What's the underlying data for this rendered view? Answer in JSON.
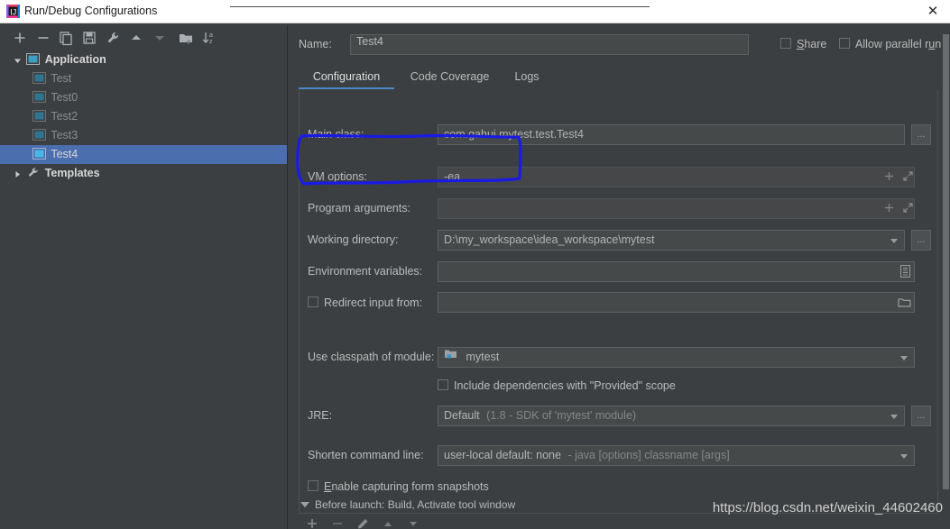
{
  "window": {
    "title": "Run/Debug Configurations",
    "icon": "intellij-idea-icon",
    "close_label": "✕"
  },
  "left_panel": {
    "toolbar": [
      {
        "name": "add-button",
        "glyph": "plus"
      },
      {
        "name": "remove-button",
        "glyph": "minus"
      },
      {
        "name": "copy-configuration-button",
        "glyph": "copy"
      },
      {
        "name": "save-configuration-button",
        "glyph": "save"
      },
      {
        "name": "edit-templates-button",
        "glyph": "wrench"
      },
      {
        "name": "move-up-button",
        "glyph": "arrow-up"
      },
      {
        "name": "move-down-button",
        "glyph": "arrow-down"
      },
      {
        "name": "create-folder-button",
        "glyph": "new-folder"
      },
      {
        "name": "sort-configurations-button",
        "glyph": "sort-az"
      }
    ],
    "tree": [
      {
        "label": "Application",
        "type": "group",
        "expanded": true,
        "selected": false,
        "icon": "application-icon"
      },
      {
        "label": "Test",
        "type": "child",
        "selected": false,
        "icon": "application-icon"
      },
      {
        "label": "Test0",
        "type": "child",
        "selected": false,
        "icon": "application-icon"
      },
      {
        "label": "Test2",
        "type": "child",
        "selected": false,
        "icon": "application-icon"
      },
      {
        "label": "Test3",
        "type": "child",
        "selected": false,
        "icon": "application-icon"
      },
      {
        "label": "Test4",
        "type": "child",
        "selected": true,
        "icon": "application-icon"
      },
      {
        "label": "Templates",
        "type": "group",
        "expanded": false,
        "selected": false,
        "icon": "wrench-icon"
      }
    ]
  },
  "right_panel": {
    "name_label": "Name:",
    "name_value": "Test4",
    "share_label_before": "S",
    "share_label_after": "hare",
    "parallel_label_before": "Allow parallel r",
    "parallel_label_mid": "u",
    "parallel_label_after": "n",
    "tabs": [
      {
        "label": "Configuration",
        "active": true
      },
      {
        "label": "Code Coverage",
        "active": false
      },
      {
        "label": "Logs",
        "active": false
      }
    ],
    "fields": {
      "main_class_label": "Main class:",
      "main_class_value": "com.gahui.mytest.test.Test4",
      "vm_options_label": "VM options:",
      "vm_options_value": "-ea",
      "program_arguments_label": "Program arguments:",
      "program_arguments_value": "",
      "working_directory_label": "Working directory:",
      "working_directory_value": "D:\\my_workspace\\idea_workspace\\mytest",
      "environment_variables_label": "Environment variables:",
      "environment_variables_value": "",
      "redirect_input_label": "Redirect input from:",
      "redirect_input_value": "",
      "use_classpath_label": "Use classpath of module:",
      "use_classpath_value": "mytest",
      "include_dependencies_label": "Include dependencies with \"Provided\" scope",
      "jre_label": "JRE:",
      "jre_value_main": "Default",
      "jre_value_detail": "(1.8 - SDK of 'mytest' module)",
      "shorten_command_line_label": "Shorten command line:",
      "shorten_value_main": "user-local default: none",
      "shorten_value_detail": "- java [options] classname [args]",
      "enable_snapshots_before": "E",
      "enable_snapshots_after": "nable capturing form snapshots",
      "ellipsis_label": "..."
    }
  },
  "footer": {
    "before_launch_label": "Before launch: Build, Activate tool window",
    "toolbar": [
      {
        "name": "add-task-button",
        "glyph": "plus"
      },
      {
        "name": "remove-task-button",
        "glyph": "minus"
      },
      {
        "name": "edit-task-button",
        "glyph": "pencil"
      },
      {
        "name": "move-task-up-button",
        "glyph": "arrow-up"
      },
      {
        "name": "move-task-down-button",
        "glyph": "arrow-down"
      }
    ]
  },
  "watermark": "https://blog.csdn.net/weixin_44602460",
  "annotation": {
    "shape": "hand-drawn-rectangle",
    "color": "#1a1ae6",
    "target": "vm-options-row"
  },
  "colors": {
    "background": "#3c3f41",
    "input_background": "#45494a",
    "selection": "#4b6eaf",
    "accent": "#4a88c7",
    "text": "#bbbbbb",
    "titlebar": "#ffffff",
    "annotation": "#1a1ae6"
  }
}
